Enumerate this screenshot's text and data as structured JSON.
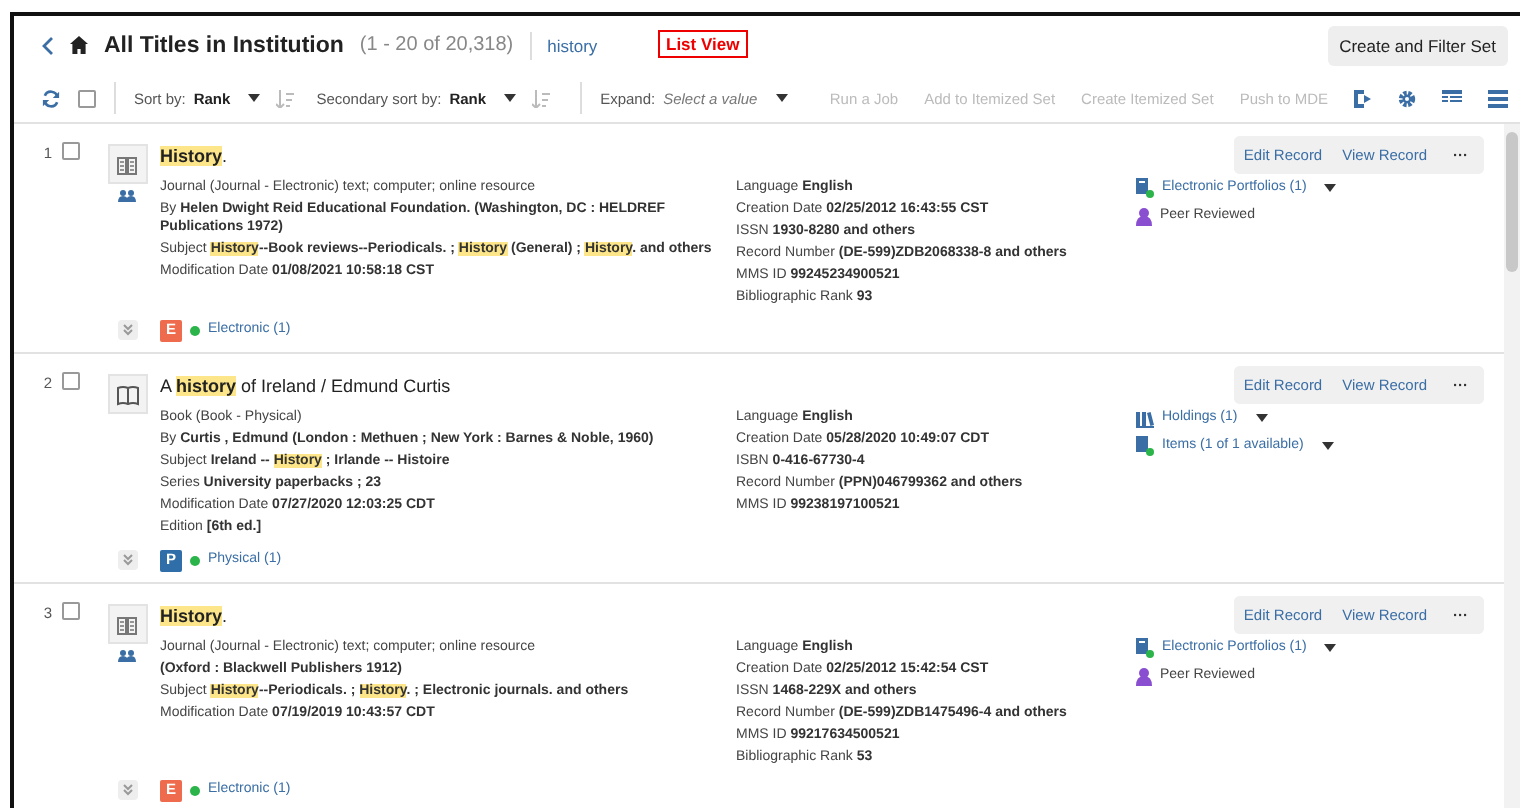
{
  "header": {
    "title": "All Titles in Institution",
    "count": "(1 - 20 of 20,318)",
    "query": "history",
    "view_label": "List View",
    "create_button": "Create and Filter Set"
  },
  "toolbar": {
    "select_all": {
      "checked": false
    },
    "sorts": [
      {
        "label": "Sort by:",
        "value": "Rank"
      },
      {
        "label": "Secondary sort by:",
        "value": "Rank"
      }
    ],
    "expand": {
      "label": "Expand:",
      "placeholder": "Select a value"
    },
    "actions": [
      {
        "label": "Run a Job",
        "disabled": true
      },
      {
        "label": "Add to Itemized Set",
        "disabled": true
      },
      {
        "label": "Create Itemized Set",
        "disabled": true
      },
      {
        "label": "Push to MDE",
        "disabled": true
      }
    ]
  },
  "records": [
    {
      "number": "1",
      "checked": false,
      "kind": "journal",
      "title": "**History**.",
      "actions": [
        "Edit Record",
        "View Record",
        "···"
      ],
      "main": [
        {
          "value": "Journal (Journal - Electronic) text; computer; online resource"
        },
        {
          "label": "By",
          "value": "Helen Dwight Reid Educational Foundation. (Washington, DC : HELDREF Publications 1972)"
        },
        {
          "label": "Subject",
          "value": "**History**--Book reviews--Periodicals. ; **History** (General) ; **History**. and others"
        },
        {
          "label": "Modification Date",
          "value": "01/08/2021 10:58:18 CST"
        }
      ],
      "details": [
        {
          "label": "Language",
          "value": "English"
        },
        {
          "label": "Creation Date",
          "value": "02/25/2012 16:43:55 CST"
        },
        {
          "label": "ISSN",
          "value": "1930-8280 and others"
        },
        {
          "label": "Record Number",
          "value": "(DE-599)ZDB2068338-8 and others"
        },
        {
          "label": "MMS ID",
          "value": "99245234900521"
        },
        {
          "label": "Bibliographic Rank",
          "value": "93"
        }
      ],
      "links": [
        {
          "kind": "portfolio",
          "text": "Electronic Portfolios (1)",
          "dropdown": true
        },
        {
          "kind": "peer",
          "text": "Peer Reviewed",
          "dropdown": false
        }
      ],
      "inventory": {
        "letter": "E",
        "color": "#ee6c4d",
        "text": "Electronic (1)"
      }
    },
    {
      "number": "2",
      "checked": false,
      "kind": "book",
      "title": "A **history** of Ireland / Edmund Curtis",
      "actions": [
        "Edit Record",
        "View Record",
        "···"
      ],
      "main": [
        {
          "value": "Book (Book - Physical)"
        },
        {
          "label": "By",
          "value": "Curtis , Edmund (London : Methuen ; New York : Barnes & Noble, 1960)"
        },
        {
          "label": "Subject",
          "value": "Ireland -- **History** ; Irlande -- Histoire"
        },
        {
          "label": "Series",
          "value": "University paperbacks ; 23"
        },
        {
          "label": "Modification Date",
          "value": "07/27/2020 12:03:25 CDT"
        },
        {
          "label": "Edition",
          "value": "[6th ed.]"
        }
      ],
      "details": [
        {
          "label": "Language",
          "value": "English"
        },
        {
          "label": "Creation Date",
          "value": "05/28/2020 10:49:07 CDT"
        },
        {
          "label": "ISBN",
          "value": "0-416-67730-4"
        },
        {
          "label": "Record Number",
          "value": "(PPN)046799362 and others"
        },
        {
          "label": "MMS ID",
          "value": "99238197100521"
        }
      ],
      "links": [
        {
          "kind": "holdings",
          "text": "Holdings (1)",
          "dropdown": true
        },
        {
          "kind": "items",
          "text": "Items (1 of 1 available)",
          "dropdown": true
        }
      ],
      "inventory": {
        "letter": "P",
        "color": "#2f6ea8",
        "text": "Physical (1)"
      }
    },
    {
      "number": "3",
      "checked": false,
      "kind": "journal",
      "title": "**History**.",
      "actions": [
        "Edit Record",
        "View Record",
        "···"
      ],
      "main": [
        {
          "value": "Journal (Journal - Electronic) text; computer; online resource"
        },
        {
          "value": "(Oxford : Blackwell Publishers 1912)",
          "strong": true
        },
        {
          "label": "Subject",
          "value": "**History**--Periodicals. ; **History**. ; Electronic journals. and others"
        },
        {
          "label": "Modification Date",
          "value": "07/19/2019 10:43:57 CDT"
        }
      ],
      "details": [
        {
          "label": "Language",
          "value": "English"
        },
        {
          "label": "Creation Date",
          "value": "02/25/2012 15:42:54 CST"
        },
        {
          "label": "ISSN",
          "value": "1468-229X and others"
        },
        {
          "label": "Record Number",
          "value": "(DE-599)ZDB1475496-4 and others"
        },
        {
          "label": "MMS ID",
          "value": "99217634500521"
        },
        {
          "label": "Bibliographic Rank",
          "value": "53"
        }
      ],
      "links": [
        {
          "kind": "portfolio",
          "text": "Electronic Portfolios (1)",
          "dropdown": true
        },
        {
          "kind": "peer",
          "text": "Peer Reviewed",
          "dropdown": false
        }
      ],
      "inventory": {
        "letter": "E",
        "color": "#ee6c4d",
        "text": "Electronic (1)"
      }
    }
  ]
}
